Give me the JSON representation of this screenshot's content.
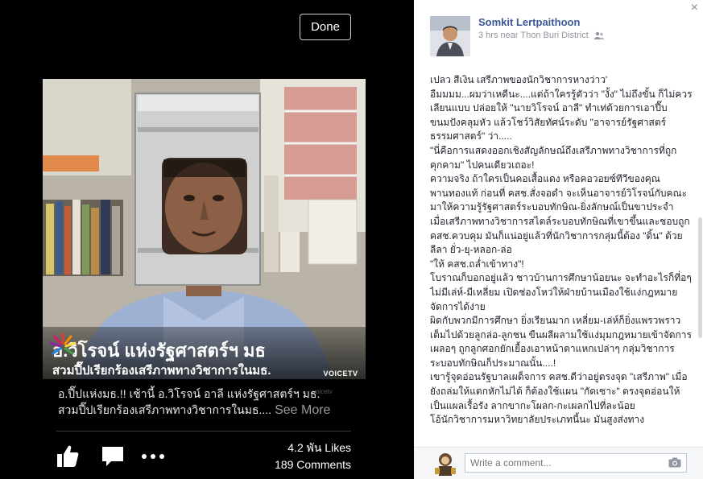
{
  "viewer": {
    "done_label": "Done",
    "photo_caption": {
      "line1": "อ.วิโรจน์ แห่งรัฐศาสตร์ฯ มธ",
      "line2": "สวมปี๊ปเรียกร้องเสรีภาพทางวิชาการในมธ.",
      "logo_text": "VOICETV",
      "watermark": "voicetv"
    },
    "post_text": {
      "line1": "อ.ปี๊ปแห่งมธ.!! เช้านี้ อ.วิโรจน์ อาลี แห่งรัฐศาสตร์ฯ มธ.",
      "line2": "สวมปี๊ปเรียกร้องเสรีภาพทางวิชาการในมธ....",
      "see_more": "See More"
    },
    "likes": "4.2 พัน Likes",
    "comments": "189 Comments",
    "icons": [
      "like-icon",
      "comment-icon",
      "more-icon"
    ]
  },
  "panel": {
    "author": "Somkit Lertpaithoon",
    "time": "3 hrs near",
    "location": "Thon Buri District",
    "privacy_icon": "friends-icon",
    "body": [
      "เปลว สีเงิน เสรีภาพของนักวิชาการหางว่าว'",
      "อืมมมม...ผมว่าเหดีนะ....แต่ถ้าใครรู้ตัวว่า \"งั้ง\" ไม่ถึงขั้น ก็ไม่ควรเลียนแบบ ปล่อยให้ \"นายวิโรจน์ อาลี\" ทำเท่ด้วยการเอาปี๊บขนมปังคลุมหัว แล้วโชว์วิสัยทัศน์ระดับ \"อาจารย์รัฐศาสตร์ ธรรมศาสตร์\" ว่า.....",
      "\"นี่คือการแสดงออกเชิงสัญลักษณ์ถึงเสรีภาพทางวิชาการที่ถูกคุกคาม\" ไปคนเดียวเถอะ!",
      "ความจริง ถ้าใครเป็นคอเสื้อแดง หรือคอวอยซ์ทีวีของคุณพานทองแท้ ก่อนที่ คสช.สั่งจอดำ จะเห็นอาจารย์วิโรจน์กับคณะ มาให้ความรู้รัฐศาสตร์ระบอบทักษิณ-ยิ่งลักษณ์เป็นขาประจำ",
      "เมื่อเสรีภาพทางวิชาการสไตล์ระบอบทักษิณที่เขาขึ้นและชอบถูก คสช.ควบคุม มันก็แน่อยู่แล้วที่นักวิชาการกลุ่มนี้ต้อง \"ดิ้น\" ด้วยลีลา ยั่ว-ยุ-หลอก-ล่อ",
      "\"ให้ คสช.ถล่ำเข้าทาง\"!",
      "โบราณก็บอกอยู่แล้ว ชาวบ้านการศึกษาน้อยนะ จะทำอะไรก็ที่อๆ ไม่มีเล่ห์-มีเหลี่ยม เปิดช่องโหว่ให้ฝ่ายบ้านเมืองใช้แง่กฎหมายจัดการได้ง่าย",
      "ผิดกับพวกมีการศึกษา ยิ่งเรียนมาก เหลี่ยม-เล่ห์ก็ยิ่งแพรวพราว เต็มไปด้วยลูกล่อ-ลูกชน ขืนผลีผลามใช้แง่มุมกฎหมายเข้าจัดการ เผลอๆ ถูกลูกศอกยักเยื้องเอาหน้าตาแหกเปล่าๆ กลุ่มวิชาการระบอบทักษิณก็ประมาณนั้น....!",
      "เขารู้จุดอ่อนรัฐบาลเผด็จการ คสช.ดีว่าอยู่ตรงจุด \"เสรีภาพ\" เมื่อยังถล่มให้แตกหักไม่ได้ ก็ต้องใช้แผน \"กัดเซาะ\" ตรงจุดอ่อนให้เป็นแผลเรื้อรัง ลากขากะโผลก-กะเผลกไปที่ละน้อย",
      "โอ้นักวิชาการมหาวิทยาลัยประเภทนี้นะ มันสูงส่งทาง"
    ],
    "comment_placeholder": "Write a comment...",
    "close_label": "×"
  }
}
